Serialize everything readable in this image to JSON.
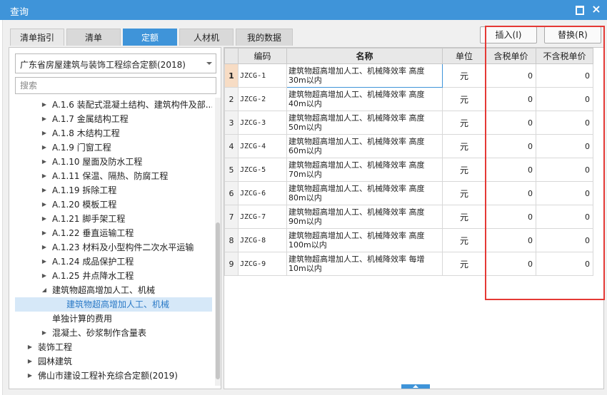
{
  "window": {
    "title": "查询",
    "restore_icon": "restore-icon",
    "close_icon": "close-icon",
    "close_glyph": "×"
  },
  "tabs": [
    "清单指引",
    "清单",
    "定额",
    "人材机",
    "我的数据"
  ],
  "active_tab": "定额",
  "buttons": {
    "insert": "插入(I)",
    "replace": "替换(R)"
  },
  "quota_select": {
    "value": "广东省房屋建筑与装饰工程综合定额(2018)"
  },
  "search": {
    "placeholder": "搜索"
  },
  "tree": [
    {
      "label": "A.1.6 装配式混凝土结构、建筑构件及部...",
      "arrow": "▶"
    },
    {
      "label": "A.1.7 金属结构工程",
      "arrow": "▶"
    },
    {
      "label": "A.1.8 木结构工程",
      "arrow": "▶"
    },
    {
      "label": "A.1.9 门窗工程",
      "arrow": "▶"
    },
    {
      "label": "A.1.10 屋面及防水工程",
      "arrow": "▶"
    },
    {
      "label": "A.1.11 保温、隔热、防腐工程",
      "arrow": "▶"
    },
    {
      "label": "A.1.19 拆除工程",
      "arrow": "▶"
    },
    {
      "label": "A.1.20 模板工程",
      "arrow": "▶"
    },
    {
      "label": "A.1.21 脚手架工程",
      "arrow": "▶"
    },
    {
      "label": "A.1.22 垂直运输工程",
      "arrow": "▶"
    },
    {
      "label": "A.1.23 材料及小型构件二次水平运输",
      "arrow": "▶"
    },
    {
      "label": "A.1.24 成品保护工程",
      "arrow": "▶"
    },
    {
      "label": "A.1.25 井点降水工程",
      "arrow": "▶"
    },
    {
      "label": "建筑物超高增加人工、机械",
      "arrow": "◢"
    },
    {
      "label": "建筑物超高增加人工、机械",
      "arrow": ""
    },
    {
      "label": "单独计算的费用",
      "arrow": ""
    },
    {
      "label": "混凝土、砂浆制作含量表",
      "arrow": "▶"
    },
    {
      "label": "装饰工程",
      "arrow": "▶"
    },
    {
      "label": "园林建筑",
      "arrow": "▶"
    },
    {
      "label": "佛山市建设工程补充综合定额(2019)",
      "arrow": "▶"
    }
  ],
  "table": {
    "headers": [
      "",
      "编码",
      "名称",
      "单位",
      "含税单价",
      "不含税单价"
    ],
    "rows": [
      {
        "no": "1",
        "code": "JZCG-1",
        "name_line1": "建筑物超高增加人工、机械降效率 高度",
        "name_line2": "30m以内",
        "unit": "元",
        "price_tax": "0",
        "price_notax": "0"
      },
      {
        "no": "2",
        "code": "JZCG-2",
        "name_line1": "建筑物超高增加人工、机械降效率 高度",
        "name_line2": "40m以内",
        "unit": "元",
        "price_tax": "0",
        "price_notax": "0"
      },
      {
        "no": "3",
        "code": "JZCG-3",
        "name_line1": "建筑物超高增加人工、机械降效率 高度",
        "name_line2": "50m以内",
        "unit": "元",
        "price_tax": "0",
        "price_notax": "0"
      },
      {
        "no": "4",
        "code": "JZCG-4",
        "name_line1": "建筑物超高增加人工、机械降效率 高度",
        "name_line2": "60m以内",
        "unit": "元",
        "price_tax": "0",
        "price_notax": "0"
      },
      {
        "no": "5",
        "code": "JZCG-5",
        "name_line1": "建筑物超高增加人工、机械降效率 高度",
        "name_line2": "70m以内",
        "unit": "元",
        "price_tax": "0",
        "price_notax": "0"
      },
      {
        "no": "6",
        "code": "JZCG-6",
        "name_line1": "建筑物超高增加人工、机械降效率 高度",
        "name_line2": "80m以内",
        "unit": "元",
        "price_tax": "0",
        "price_notax": "0"
      },
      {
        "no": "7",
        "code": "JZCG-7",
        "name_line1": "建筑物超高增加人工、机械降效率 高度",
        "name_line2": "90m以内",
        "unit": "元",
        "price_tax": "0",
        "price_notax": "0"
      },
      {
        "no": "8",
        "code": "JZCG-8",
        "name_line1": "建筑物超高增加人工、机械降效率 高度",
        "name_line2": "100m以内",
        "unit": "元",
        "price_tax": "0",
        "price_notax": "0"
      },
      {
        "no": "9",
        "code": "JZCG-9",
        "name_line1": "建筑物超高增加人工、机械降效率 每增",
        "name_line2": "10m以内",
        "unit": "元",
        "price_tax": "0",
        "price_notax": "0"
      }
    ]
  },
  "colors": {
    "accent": "#3f94d9",
    "highlight": "#e53935",
    "selected_row": "#d6e8f8"
  }
}
